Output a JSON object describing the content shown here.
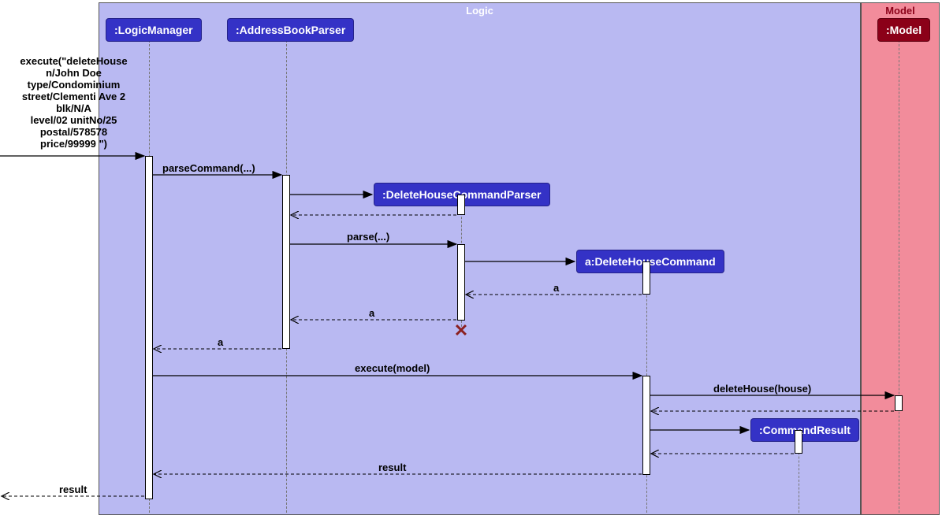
{
  "regions": {
    "logic": {
      "label": "Logic",
      "bg": "#B9B9F2",
      "labelColor": "#fff"
    },
    "model": {
      "label": "Model",
      "bg": "#F28C9B",
      "labelColor": "#8B0018"
    }
  },
  "participants": {
    "logicManager": ":LogicManager",
    "addressBookParser": ":AddressBookParser",
    "deleteHouseCommandParser": ":DeleteHouseCommandParser",
    "deleteHouseCommand": "a:DeleteHouseCommand",
    "commandResult": ":CommandResult",
    "model": ":Model"
  },
  "messages": {
    "execCall": "execute(\"deleteHouse\nn/John Doe\ntype/Condominium\nstreet/Clementi Ave 2\nblk/N/A\nlevel/02 unitNo/25\npostal/578578\nprice/99999 \")",
    "parseCommand": "parseCommand(...)",
    "parse": "parse(...)",
    "a1": "a",
    "a2": "a",
    "a3": "a",
    "executeModel": "execute(model)",
    "deleteHouse": "deleteHouse(house)",
    "result1": "result",
    "result2": "result"
  }
}
